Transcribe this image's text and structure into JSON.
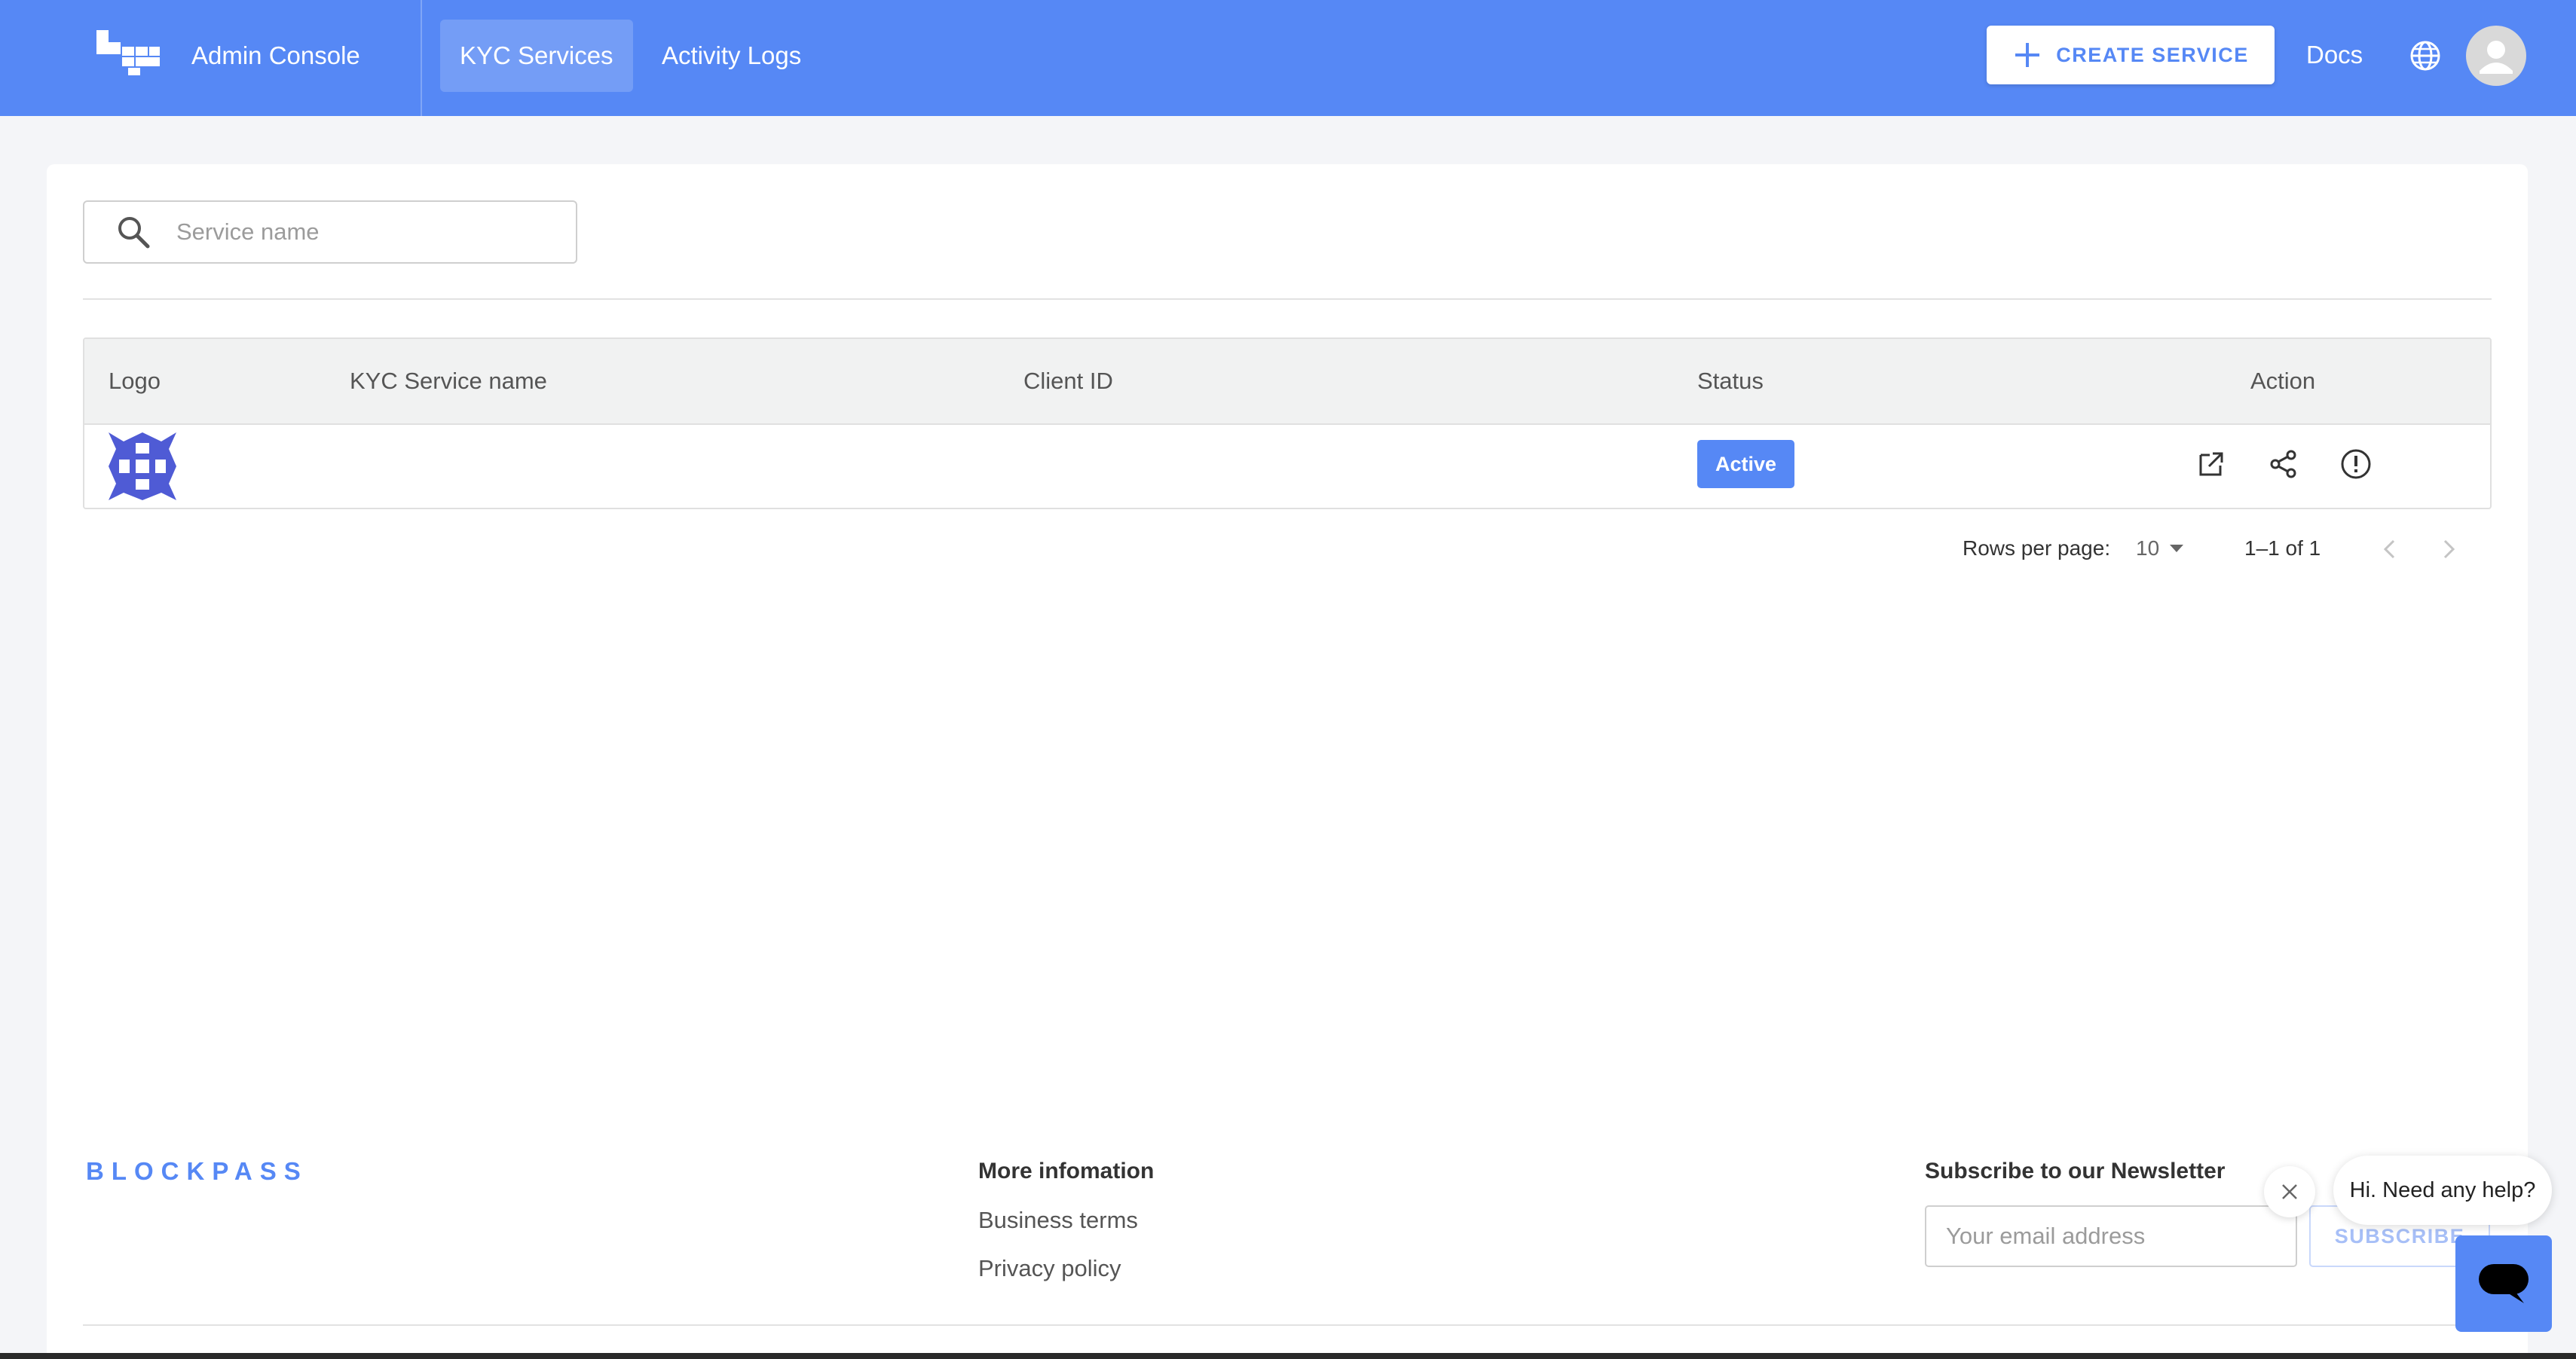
{
  "header": {
    "app_title": "Admin Console",
    "tabs": [
      {
        "label": "KYC Services",
        "active": true
      },
      {
        "label": "Activity Logs",
        "active": false
      }
    ],
    "create_button_label": "CREATE SERVICE",
    "docs_label": "Docs",
    "accent_color": "#5688f5"
  },
  "search": {
    "placeholder": "Service name"
  },
  "table": {
    "columns": [
      "Logo",
      "KYC Service name",
      "Client ID",
      "Status",
      "Action"
    ],
    "rows": [
      {
        "service_name": "",
        "client_id": "",
        "status": "Active",
        "actions": [
          "open-external-icon",
          "share-icon",
          "info-icon"
        ]
      }
    ]
  },
  "pagination": {
    "rows_per_page_label": "Rows per page:",
    "rows_per_page_value": "10",
    "range_label": "1–1 of 1"
  },
  "footer": {
    "brand": "BLOCKPASS",
    "more_info_heading": "More infomation",
    "links": [
      "Business terms",
      "Privacy policy"
    ],
    "newsletter_heading": "Subscribe to our Newsletter",
    "email_placeholder": "Your email address",
    "subscribe_label": "SUBSCRIBE"
  },
  "chat": {
    "bubble_text": "Hi. Need any help?"
  }
}
